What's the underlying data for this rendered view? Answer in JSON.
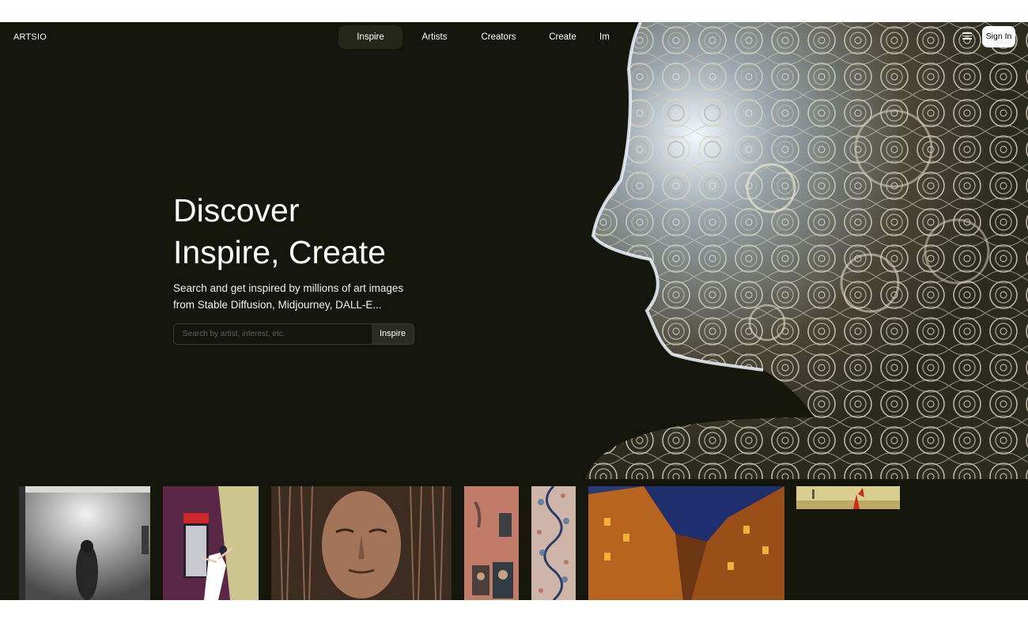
{
  "header": {
    "logo": "ARTSIO",
    "nav_tabs": [
      {
        "label": "Inspire",
        "active": true
      },
      {
        "label": "Artists",
        "active": false
      },
      {
        "label": "Creators",
        "active": false
      },
      {
        "label": "Create",
        "active": false
      },
      {
        "label": "Im",
        "active": false
      }
    ],
    "menu_icon": "hamburger-menu-icon",
    "sign_in_label": "Sign In"
  },
  "hero": {
    "title_line1": "Discover",
    "title_line2": "Inspire, Create",
    "subtitle_line1": "Search and get inspired by millions of art images",
    "subtitle_line2": "from Stable Diffusion, Midjourney, DALL-E...",
    "search_placeholder": "Search by artist, interest, etc.",
    "search_button_label": "Inspire"
  },
  "colors": {
    "background": "#15160b",
    "active_tab": "#24261a",
    "text": "#ffffff"
  }
}
